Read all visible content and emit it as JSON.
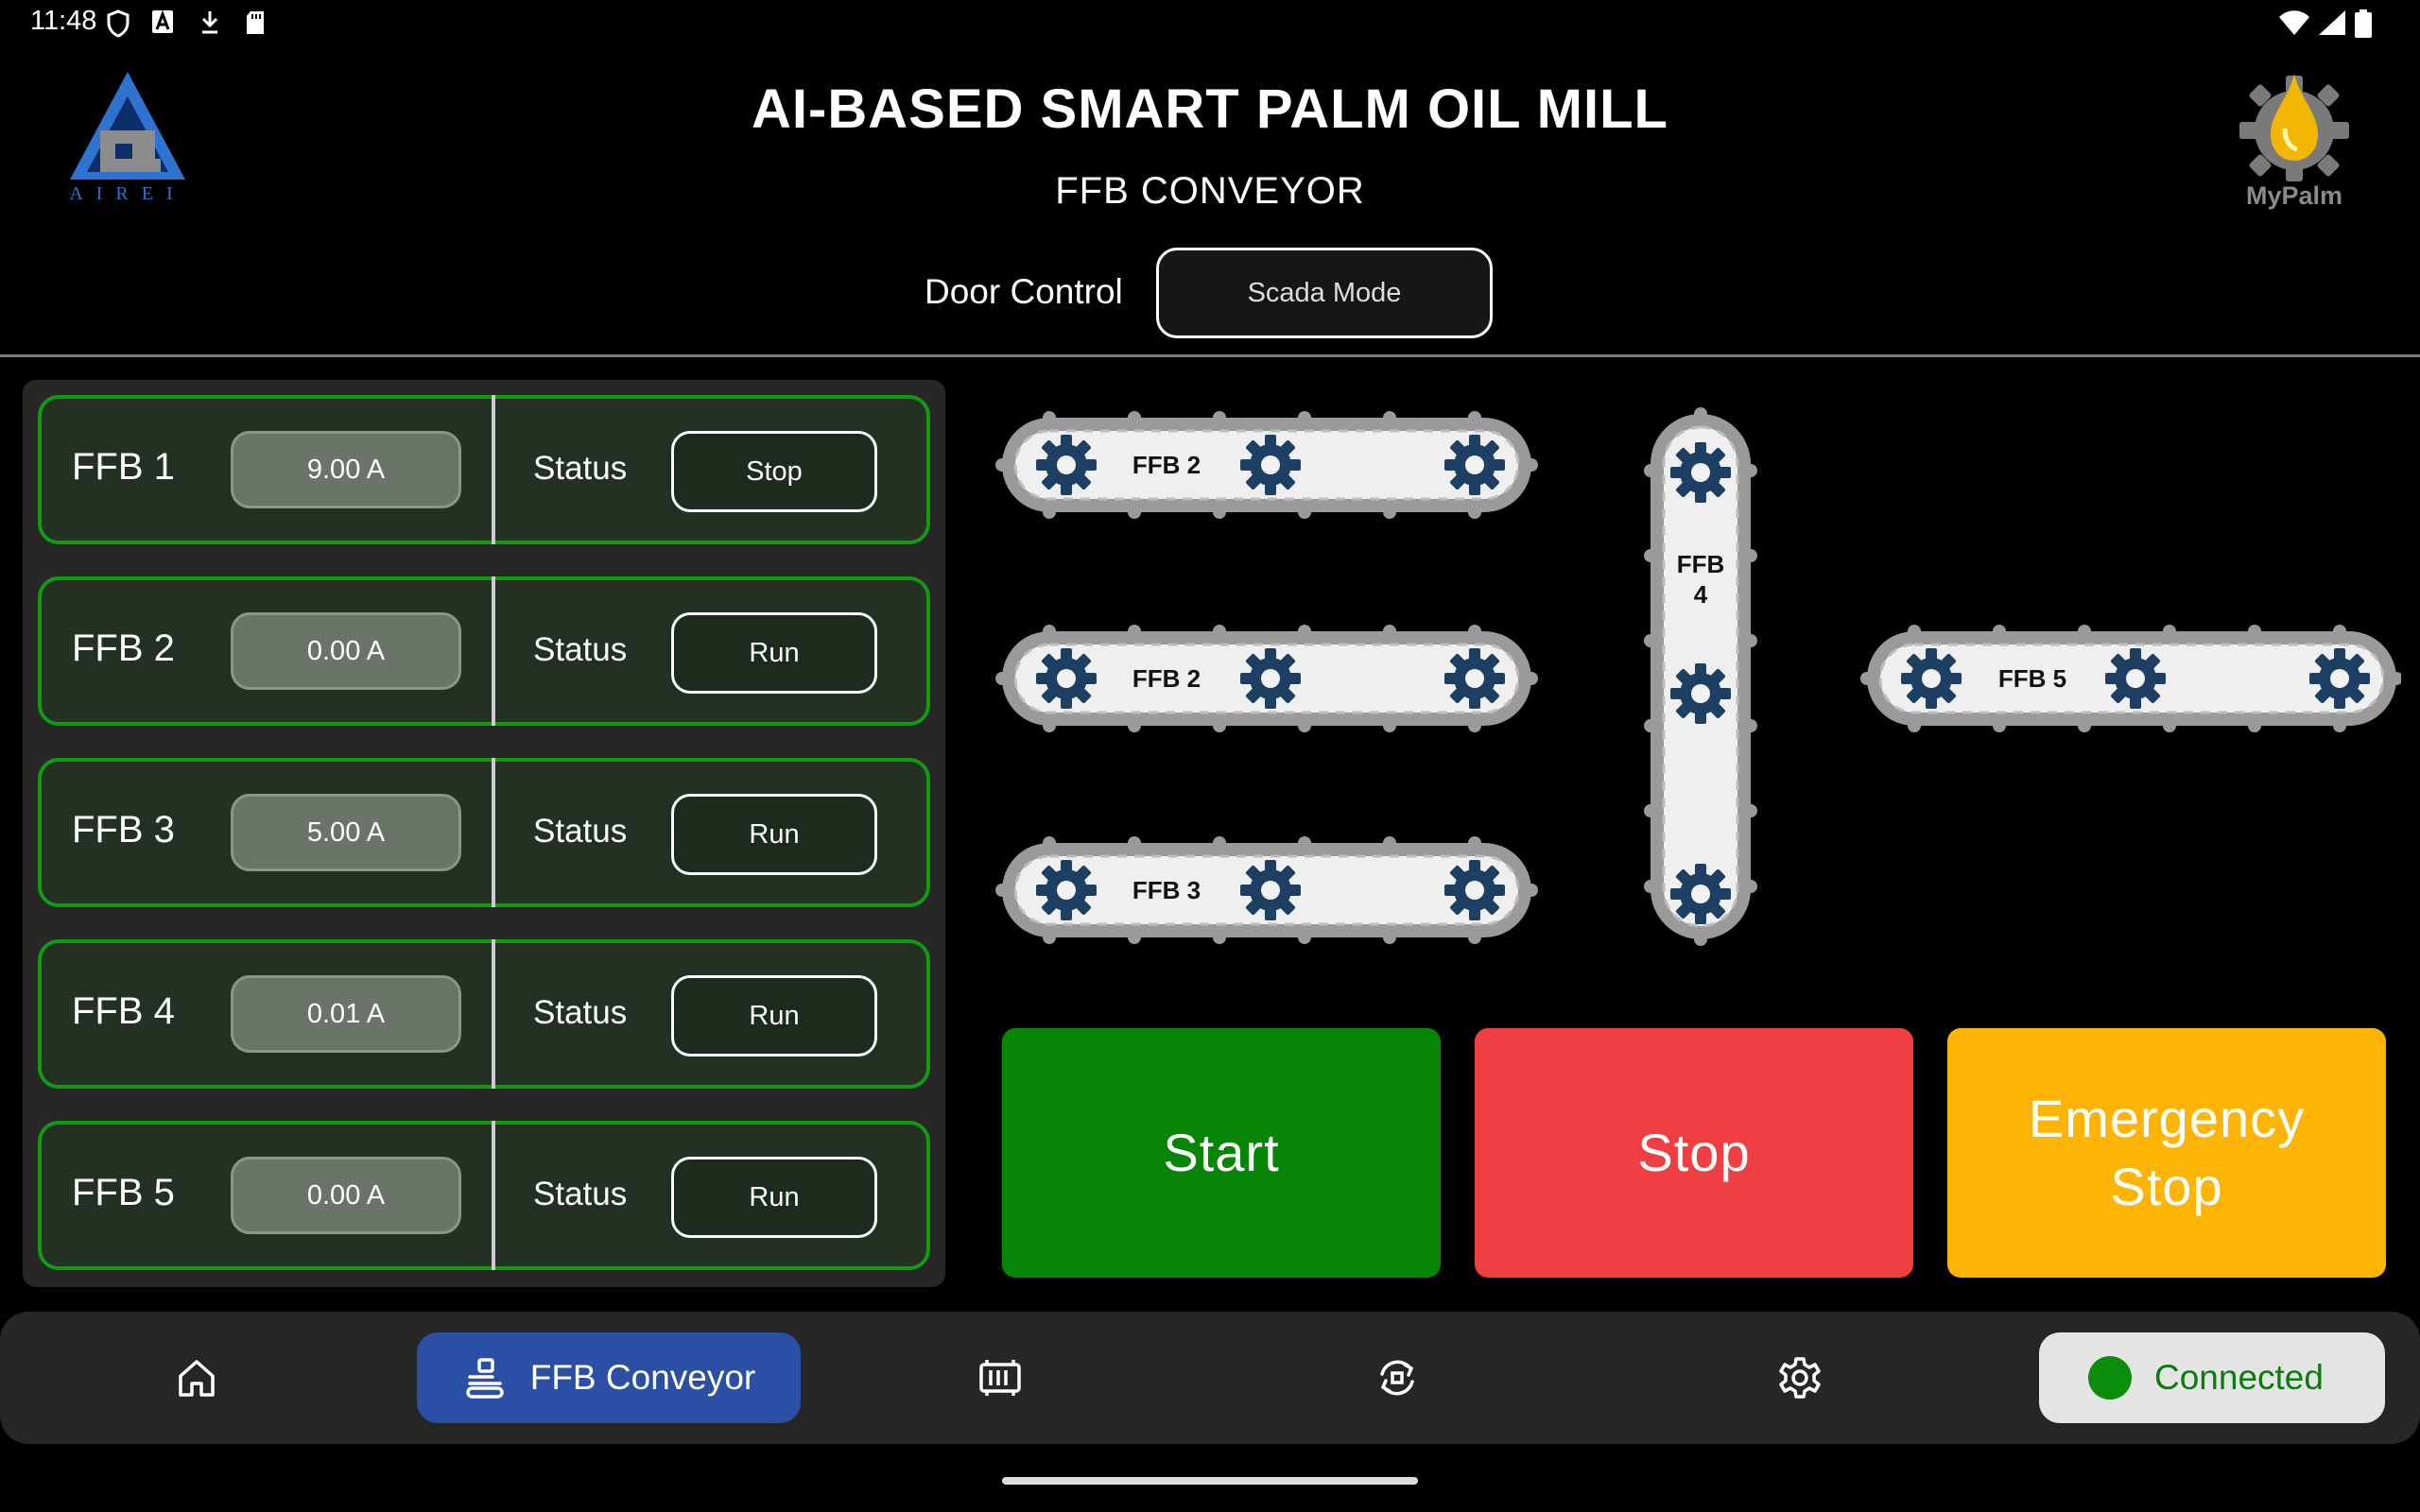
{
  "status_bar": {
    "time": "11:48",
    "icons_left": [
      "shield-icon",
      "font-a-icon",
      "download-icon",
      "sd-card-icon"
    ],
    "icons_right": [
      "wifi-icon",
      "signal-icon",
      "battery-icon"
    ]
  },
  "header": {
    "title": "AI-BASED SMART PALM OIL MILL",
    "subtitle": "FFB CONVEYOR",
    "left_logo_text": "AIREI",
    "right_logo_text": "MyPalm",
    "door_control_label": "Door Control",
    "door_mode_button": "Scada Mode"
  },
  "ffb_list": [
    {
      "name": "FFB 1",
      "current": "9.00 A",
      "status_label": "Status",
      "status": "Stop"
    },
    {
      "name": "FFB 2",
      "current": "0.00 A",
      "status_label": "Status",
      "status": "Run"
    },
    {
      "name": "FFB 3",
      "current": "5.00 A",
      "status_label": "Status",
      "status": "Run"
    },
    {
      "name": "FFB 4",
      "current": "0.01 A",
      "status_label": "Status",
      "status": "Run"
    },
    {
      "name": "FFB 5",
      "current": "0.00 A",
      "status_label": "Status",
      "status": "Run"
    }
  ],
  "conveyors": {
    "top": "FFB 2",
    "middle": "FFB 2",
    "bottom": "FFB 3",
    "vertical_line1": "FFB",
    "vertical_line2": "4",
    "right": "FFB 5"
  },
  "controls": {
    "start": "Start",
    "stop": "Stop",
    "emergency_line1": "Emergency",
    "emergency_line2": "Stop"
  },
  "bottom_nav": {
    "items": [
      {
        "icon": "home-icon"
      },
      {
        "icon": "conveyor-icon",
        "label": "FFB Conveyor",
        "active": true
      },
      {
        "icon": "machine-icon"
      },
      {
        "icon": "sync-icon"
      },
      {
        "icon": "settings-icon"
      }
    ],
    "connection_status": "Connected"
  },
  "colors": {
    "start": "#068506",
    "stop": "#ef3f42",
    "emergency": "#fdb405",
    "row_border": "#129a12",
    "nav_active": "#2c4fa6",
    "gear": "#1d3f63"
  }
}
